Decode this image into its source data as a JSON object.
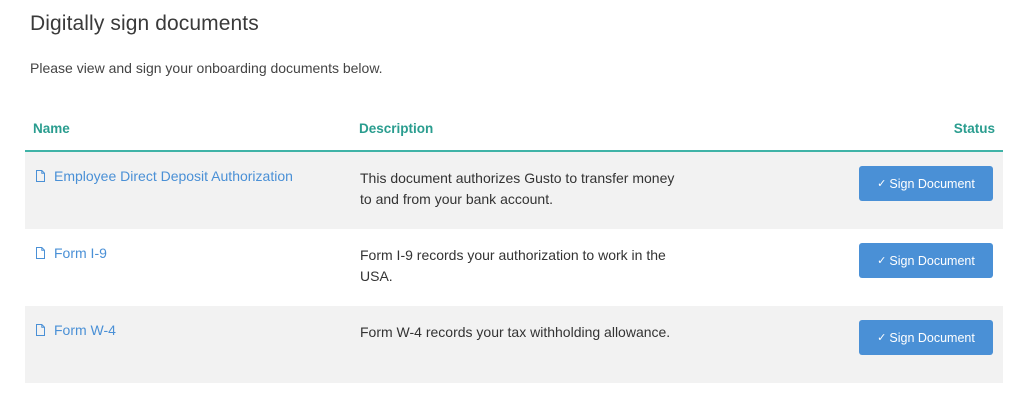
{
  "page": {
    "title": "Digitally sign documents",
    "subtitle": "Please view and sign your onboarding documents below."
  },
  "table": {
    "columns": {
      "name": "Name",
      "description": "Description",
      "status": "Status"
    },
    "rows": [
      {
        "name": "Employee Direct Deposit Authorization",
        "description": "This document authorizes Gusto to transfer money to and from your bank account.",
        "action_label": "Sign Document",
        "action_icon": "check-icon"
      },
      {
        "name": "Form I-9",
        "description": "Form I-9 records your authorization to work in the USA.",
        "action_label": "Sign Document",
        "action_icon": "check-icon"
      },
      {
        "name": "Form W-4",
        "description": "Form W-4 records your tax withholding allowance.",
        "action_label": "Sign Document",
        "action_icon": "check-icon"
      }
    ]
  },
  "colors": {
    "accent_teal": "#2a9d8f",
    "link_blue": "#4a90d6",
    "button_blue": "#4a90d6",
    "row_shade": "#f2f2f2"
  }
}
